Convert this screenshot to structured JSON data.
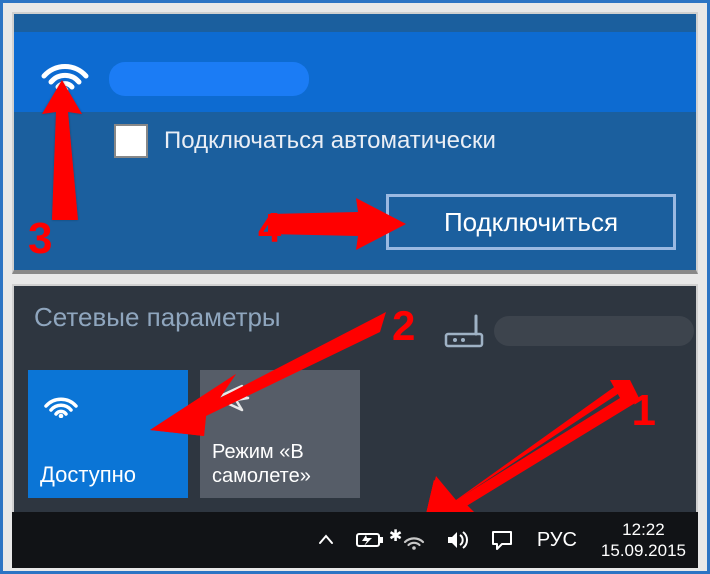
{
  "wifi_flyout": {
    "auto_connect_label": "Подключаться автоматически",
    "connect_button": "Подключиться"
  },
  "network_settings": {
    "title": "Сетевые параметры",
    "wifi_tile_label": "Доступно",
    "airplane_tile_label": "Режим «В самолете»"
  },
  "taskbar": {
    "language": "РУС",
    "time": "12:22",
    "date": "15.09.2015"
  },
  "annotations": {
    "n1": "1",
    "n2": "2",
    "n3": "3",
    "n4": "4"
  }
}
